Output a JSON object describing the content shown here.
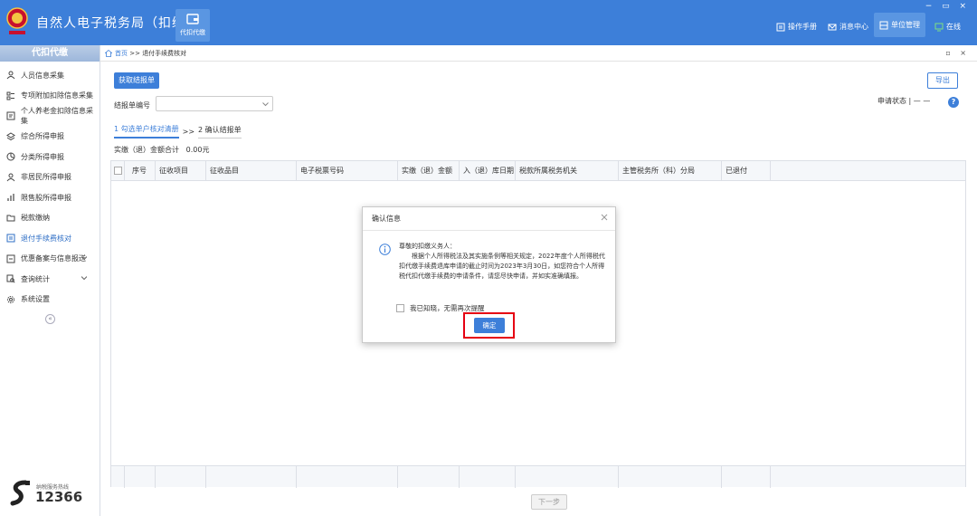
{
  "header": {
    "title": "自然人电子税务局（扣缴端）",
    "tab_label": "代扣代缴",
    "links": [
      "操作手册",
      "消息中心",
      "单位管理",
      "在线"
    ],
    "window_controls": "− ▭ ×",
    "brand_color": "#3d7fd9"
  },
  "sidebar": {
    "heading": "代扣代缴",
    "items": [
      {
        "label": "人员信息采集",
        "icon": "person-icon"
      },
      {
        "label": "专项附加扣除信息采集",
        "icon": "list-icon"
      },
      {
        "label": "个人养老金扣除信息采集",
        "icon": "document-icon"
      },
      {
        "label": "综合所得申报",
        "icon": "layers-icon"
      },
      {
        "label": "分类所得申报",
        "icon": "pie-icon"
      },
      {
        "label": "非居民所得申报",
        "icon": "person-icon"
      },
      {
        "label": "限售股所得申报",
        "icon": "bar-chart-icon"
      },
      {
        "label": "税款缴纳",
        "icon": "folder-icon"
      },
      {
        "label": "退付手续费核对",
        "icon": "receipt-icon",
        "active": true
      },
      {
        "label": "优惠备案与信息报送",
        "icon": "file-icon",
        "expandable": true
      },
      {
        "label": "查询统计",
        "icon": "search-icon",
        "expandable": true
      },
      {
        "label": "系统设置",
        "icon": "gear-icon"
      }
    ],
    "collapse": "«",
    "hotline_caption": "纳税服务热线",
    "hotline_number": "12366"
  },
  "breadcrumb": {
    "home": "首页",
    "sep": " >> ",
    "current": "退付手续费核对",
    "controls": "▫ ×"
  },
  "main": {
    "fetch_button": "获取结报单",
    "export_button": "导出",
    "field_label": "结报单编号",
    "status_text": "申请状态 | — —",
    "help": "?",
    "step1": "1 勾选单户核对清册",
    "step_sep": ">>",
    "step2": "2 确认结报单",
    "total": "实缴（退）金额合计   0.00元",
    "next_button": "下一步"
  },
  "table": {
    "columns": [
      "序号",
      "征收项目",
      "征收品目",
      "电子税票号码",
      "实缴（退）金额",
      "入（退）库日期",
      "税款所属税务机关",
      "主管税务所（科）分局",
      "已退付"
    ]
  },
  "dialog": {
    "title": "确认信息",
    "salutation": "尊敬的扣缴义务人：",
    "message": "根据个人所得税法及其实施条例等相关规定，2022年度个人所得税代扣代缴手续费退库申请的截止时间为2023年3月30日，如您符合个人所得税代扣代缴手续费的申请条件，请您尽快申请，并如实准确填报。",
    "checkbox_label": "我已知晓，无需再次提醒",
    "ok_button": "确定",
    "highlight_color": "#e60012"
  }
}
